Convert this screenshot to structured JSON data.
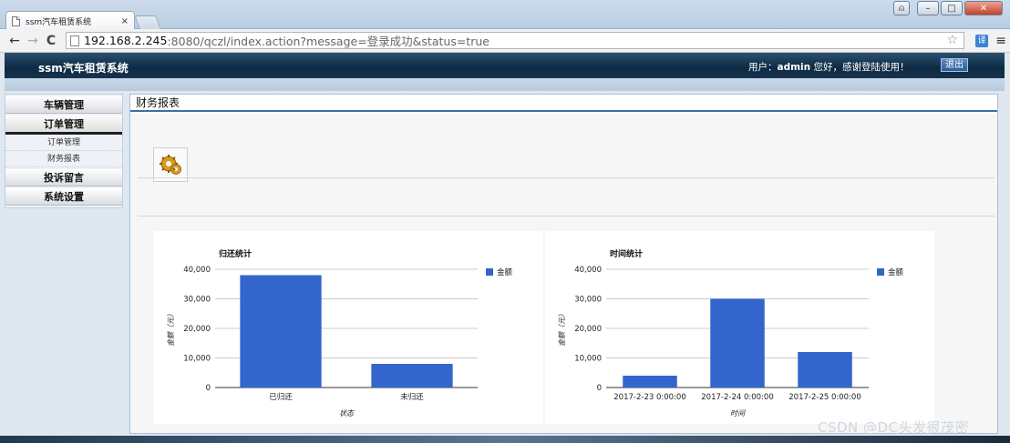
{
  "browser": {
    "tab_title": "ssm汽车租赁系统",
    "tab_close": "×",
    "address": {
      "host": "192.168.2.245",
      "rest": ":8080/qczl/index.action?message=登录成功&status=true"
    },
    "ext_label": "译",
    "nav": {
      "back": "←",
      "forward": "→",
      "reload": "C"
    },
    "window_buttons": {
      "user": "⍝",
      "min": "–",
      "max": "□",
      "close": "✕"
    }
  },
  "header": {
    "app_title": "ssm汽车租赁系统",
    "welcome_prefix": "用户：",
    "username": "admin",
    "welcome_suffix": " 您好，感谢登陆使用！",
    "logout_label": "退出"
  },
  "sidebar": {
    "groups": [
      {
        "label": "车辆管理"
      },
      {
        "label": "订单管理",
        "items": [
          "订单管理",
          "财务报表"
        ]
      },
      {
        "label": "投诉留言"
      },
      {
        "label": "系统设置"
      }
    ]
  },
  "main": {
    "panel_title": "财务报表"
  },
  "colors": {
    "bar": "#3366cc",
    "header_dark": "#0e2a44"
  },
  "chart_data": [
    {
      "type": "bar",
      "title": "归还统计",
      "categories": [
        "已归还",
        "未归还"
      ],
      "series": [
        {
          "name": "金额",
          "values": [
            38000,
            8000
          ]
        }
      ],
      "xlabel": "状态",
      "ylabel": "金额（元）",
      "ylim": [
        0,
        40000
      ],
      "yticks": [
        "0",
        "10,000",
        "20,000",
        "30,000",
        "40,000"
      ],
      "grid": true,
      "legend": "right"
    },
    {
      "type": "bar",
      "title": "时间统计",
      "categories": [
        "2017-2-23 0:00:00",
        "2017-2-24 0:00:00",
        "2017-2-25 0:00:00"
      ],
      "series": [
        {
          "name": "金额",
          "values": [
            4000,
            30000,
            12000
          ]
        }
      ],
      "xlabel": "时间",
      "ylabel": "金额（元）",
      "ylim": [
        0,
        40000
      ],
      "yticks": [
        "0",
        "10,000",
        "20,000",
        "30,000",
        "40,000"
      ],
      "grid": true,
      "legend": "right"
    }
  ],
  "watermark": "CSDN @DC头发很茂密"
}
